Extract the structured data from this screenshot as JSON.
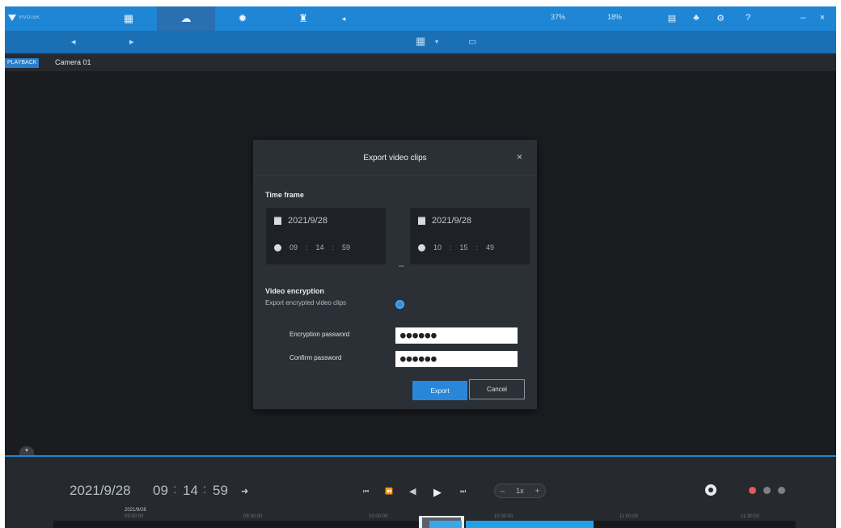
{
  "topbar": {
    "logo_text": "VIVOTEK",
    "nav_icons": [
      "monitor-icon",
      "cloud-playback-icon",
      "gear-icon",
      "person-icon",
      "dropdown-icon"
    ],
    "stats": [
      "37%",
      "18%"
    ],
    "right_icons": [
      "list-icon",
      "bell-icon",
      "settings-icon",
      "help-icon",
      "minimize-icon",
      "close-icon"
    ]
  },
  "tabstrip": {
    "badge": "PLAYBACK",
    "camera": "Camera 01"
  },
  "dialog": {
    "title": "Export video clips",
    "close_glyph": "×",
    "time_frame_label": "Time frame",
    "start": {
      "date": "2021/9/28",
      "h": "09",
      "m": "14",
      "s": "59"
    },
    "end": {
      "date": "2021/9/28",
      "h": "10",
      "m": "15",
      "s": "49"
    },
    "range_dash": "–",
    "encryption_title": "Video encryption",
    "encryption_text": "Export encrypted video clips",
    "encryption_enabled": true,
    "password_label": "Encryption password",
    "password_value": "●●●●●●",
    "confirm_label": "Confirm password",
    "confirm_value": "●●●●●●",
    "export_label": "Export",
    "cancel_label": "Cancel"
  },
  "playback": {
    "date": "2021/9/28",
    "h": "09",
    "m": "14",
    "s": "59",
    "date_small": "2021/9/28",
    "ticks": [
      "09:00:00",
      "09:30:00",
      "10:00:00",
      "10:30:00",
      "11:00:00",
      "11:30:00"
    ],
    "speed_value": "1x",
    "colors": {
      "accent": "#1f86d6",
      "record": "#22a0e6",
      "alarm": "#e25b5b"
    }
  }
}
